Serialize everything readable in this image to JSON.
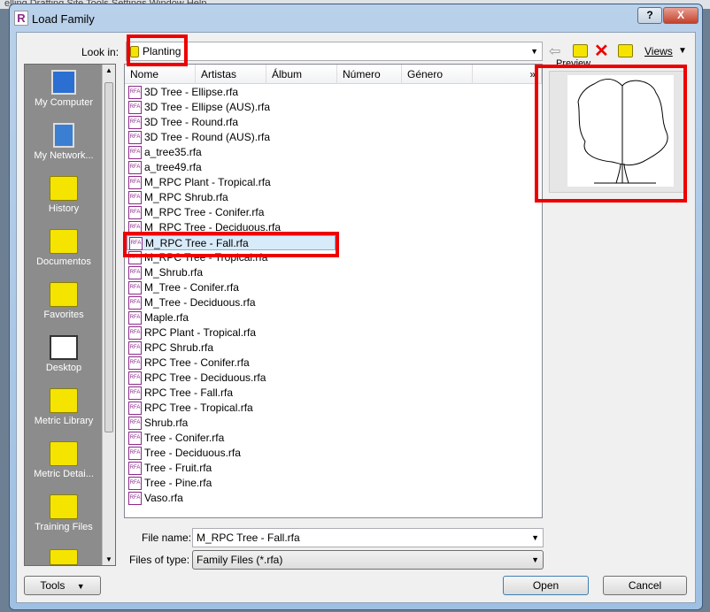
{
  "app_menu": "elling   Drafting   Site   Tools   Settings   Window   Help",
  "window": {
    "title": "Load Family",
    "help": "?",
    "close": "X"
  },
  "look_in": {
    "label": "Look in:",
    "value": "Planting"
  },
  "toolbar": {
    "views": "Views"
  },
  "preview_label": "Preview",
  "places": [
    "My Computer",
    "My Network...",
    "History",
    "Documentos",
    "Favorites",
    "Desktop",
    "Metric Library",
    "Metric Detai...",
    "Training Files"
  ],
  "columns": [
    "Nome",
    "Artistas",
    "Álbum",
    "Número",
    "Género"
  ],
  "more_columns": "»",
  "file_icon": "RFA",
  "files": [
    "3D Tree - Ellipse.rfa",
    "3D Tree - Ellipse (AUS).rfa",
    "3D Tree - Round.rfa",
    "3D Tree - Round (AUS).rfa",
    "a_tree35.rfa",
    "a_tree49.rfa",
    "M_RPC Plant - Tropical.rfa",
    "M_RPC Shrub.rfa",
    "M_RPC Tree - Conifer.rfa",
    "M_RPC Tree - Deciduous.rfa",
    "M_RPC Tree - Fall.rfa",
    "M_RPC Tree - Tropical.rfa",
    "M_Shrub.rfa",
    "M_Tree - Conifer.rfa",
    "M_Tree - Deciduous.rfa",
    "Maple.rfa",
    "RPC Plant - Tropical.rfa",
    "RPC Shrub.rfa",
    "RPC Tree - Conifer.rfa",
    "RPC Tree - Deciduous.rfa",
    "RPC Tree - Fall.rfa",
    "RPC Tree - Tropical.rfa",
    "Shrub.rfa",
    "Tree - Conifer.rfa",
    "Tree - Deciduous.rfa",
    "Tree - Fruit.rfa",
    "Tree - Pine.rfa",
    "Vaso.rfa"
  ],
  "selected_index": 10,
  "file_name": {
    "label": "File name:",
    "value": "M_RPC Tree - Fall.rfa"
  },
  "file_type": {
    "label": "Files of type:",
    "value": "Family Files  (*.rfa)"
  },
  "buttons": {
    "tools": "Tools",
    "open": "Open",
    "cancel": "Cancel"
  },
  "colors": {
    "highlight": "#e00000",
    "selection": "#d8ebf9"
  }
}
